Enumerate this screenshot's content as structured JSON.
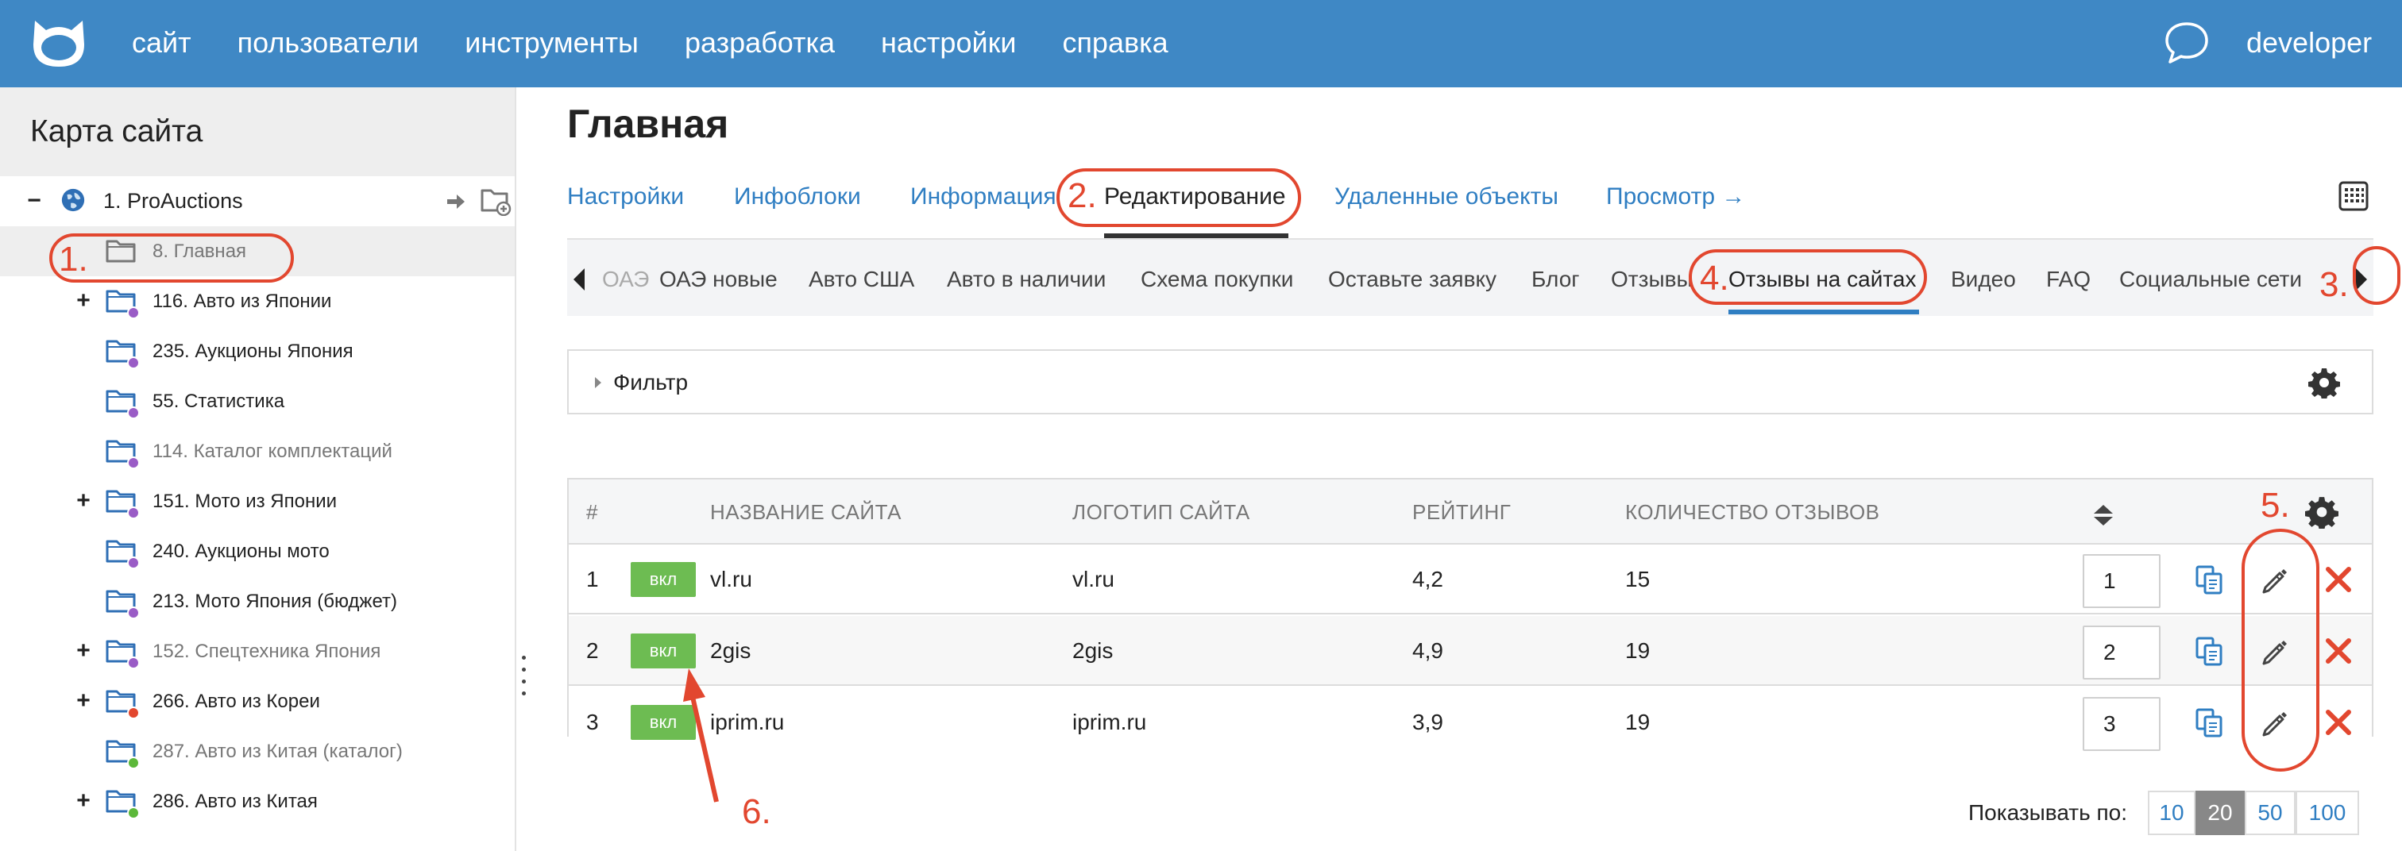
{
  "header": {
    "nav": [
      "сайт",
      "пользователи",
      "инструменты",
      "разработка",
      "настройки",
      "справка"
    ],
    "user": "developer"
  },
  "sidebar": {
    "title": "Карта сайта",
    "items": [
      {
        "label": "1. ProAuctions",
        "toggle": "−",
        "icon": "globe-icon"
      },
      {
        "label": "8. Главная",
        "toggle": "",
        "icon": "folder-icon",
        "dot": "",
        "muted": true,
        "selected": true
      },
      {
        "label": "116. Авто из Японии",
        "toggle": "+",
        "icon": "folder-icon",
        "dot": "#9a5cc6"
      },
      {
        "label": "235. Аукционы Япония",
        "toggle": "",
        "icon": "folder-icon",
        "dot": "#9a5cc6"
      },
      {
        "label": "55. Статистика",
        "toggle": "",
        "icon": "folder-icon",
        "dot": "#9a5cc6"
      },
      {
        "label": "114. Каталог комплектаций",
        "toggle": "",
        "icon": "folder-icon",
        "dot": "#9a5cc6",
        "muted": true
      },
      {
        "label": "151. Мото из Японии",
        "toggle": "+",
        "icon": "folder-icon",
        "dot": "#9a5cc6"
      },
      {
        "label": "240. Аукционы мото",
        "toggle": "",
        "icon": "folder-icon",
        "dot": "#9a5cc6"
      },
      {
        "label": "213. Мото Япония (бюджет)",
        "toggle": "",
        "icon": "folder-icon",
        "dot": "#9a5cc6"
      },
      {
        "label": "152. Спецтехника Япония",
        "toggle": "+",
        "icon": "folder-icon",
        "dot": "#9a5cc6",
        "muted": true
      },
      {
        "label": "266. Авто из Кореи",
        "toggle": "+",
        "icon": "folder-icon",
        "dot": "#e2472f"
      },
      {
        "label": "287. Авто из Китая (каталог)",
        "toggle": "",
        "icon": "folder-icon",
        "dot": "#5cb83a",
        "muted": true
      },
      {
        "label": "286. Авто из Китая",
        "toggle": "+",
        "icon": "folder-icon",
        "dot": "#5cb83a"
      }
    ]
  },
  "page": {
    "title": "Главная",
    "tabs": [
      "Настройки",
      "Инфоблоки",
      "Информация",
      "Редактирование",
      "Удаленные объекты",
      "Просмотр →"
    ],
    "subnav": [
      "ОАЭ",
      "ОАЭ новые",
      "Авто США",
      "Авто в наличии",
      "Схема покупки",
      "Оставьте заявку",
      "Блог",
      "Отзывы",
      "Отзывы на сайтах",
      "Видео",
      "FAQ",
      "Социальные сети"
    ],
    "filter_label": "Фильтр"
  },
  "table": {
    "headers": [
      "#",
      "НАЗВАНИЕ САЙТА",
      "ЛОГОТИП САЙТА",
      "РЕЙТИНГ",
      "КОЛИЧЕСТВО ОТЗЫВОВ"
    ],
    "rows": [
      {
        "n": "1",
        "status": "вкл",
        "name": "vl.ru",
        "logo": "vl.ru",
        "rating": "4,2",
        "count": "15",
        "order": "1"
      },
      {
        "n": "2",
        "status": "вкл",
        "name": "2gis",
        "logo": "2gis",
        "rating": "4,9",
        "count": "19",
        "order": "2"
      },
      {
        "n": "3",
        "status": "вкл",
        "name": "iprim.ru",
        "logo": "iprim.ru",
        "rating": "3,9",
        "count": "19",
        "order": "3"
      }
    ]
  },
  "pagination": {
    "label": "Показывать по:",
    "options": [
      "10",
      "20",
      "50",
      "100"
    ],
    "selected": "20"
  },
  "annotations": [
    "1.",
    "2.",
    "3.",
    "4.",
    "5.",
    "6."
  ],
  "colors": {
    "topbar": "#3f88c5",
    "link": "#2f7ec2",
    "badge": "#6dbc52",
    "delete": "#e2472f",
    "annotation": "#e2472f"
  }
}
